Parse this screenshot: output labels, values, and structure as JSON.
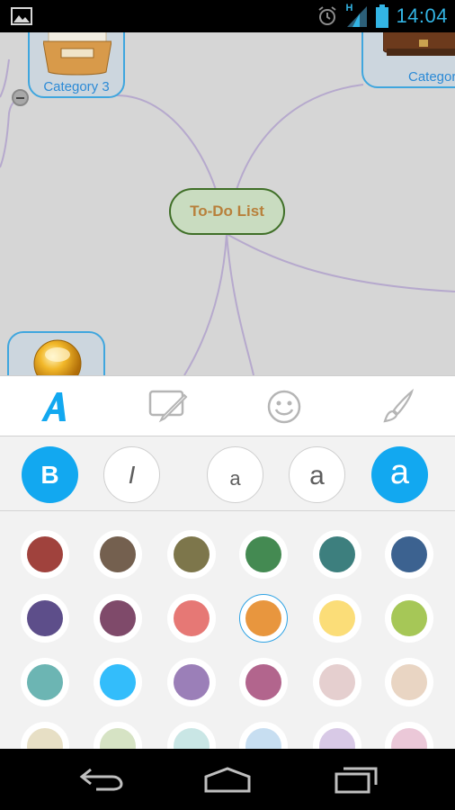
{
  "status_bar": {
    "time": "14:04",
    "network_label": "H",
    "left_icon": "image-icon",
    "right_icons": [
      "alarm-icon",
      "signal-icon",
      "battery-icon"
    ]
  },
  "mind_map": {
    "central_node": {
      "label": "To-Do List",
      "text_color": "#b8803b",
      "border_color": "#3f6f27",
      "fill_color": "#c9dcc0"
    },
    "nodes": [
      {
        "label": "Category 3",
        "icon": "tray-icon"
      },
      {
        "label": "Categor",
        "icon": "briefcase-icon"
      },
      {
        "label": "",
        "icon": "gold-ball-icon"
      }
    ],
    "link_color": "#b6a9cd",
    "node_border_color": "#3fa6de"
  },
  "format_panel": {
    "tabs": [
      {
        "name": "text-style",
        "icon": "font-a-icon",
        "active": true
      },
      {
        "name": "image",
        "icon": "image-brush-icon",
        "active": false
      },
      {
        "name": "emoji",
        "icon": "smiley-icon",
        "active": false
      },
      {
        "name": "brush",
        "icon": "brush-icon",
        "active": false
      }
    ],
    "styles": [
      {
        "label": "B",
        "active": true,
        "name": "bold"
      },
      {
        "label": "I",
        "active": false,
        "name": "italic"
      },
      {
        "label": "a",
        "active": false,
        "name": "size-small"
      },
      {
        "label": "a",
        "active": false,
        "name": "size-medium"
      },
      {
        "label": "a",
        "active": true,
        "name": "size-large"
      }
    ],
    "accent_color": "#12a8f0",
    "colors": [
      "#a0423d",
      "#74604f",
      "#7d764b",
      "#448a52",
      "#3d7f7e",
      "#3c6290",
      "#5d4e8a",
      "#7f4a6a",
      "#e67875",
      "#e8963e",
      "#fbdd78",
      "#a6c757",
      "#6cb5b3",
      "#33bdfb",
      "#9b7fb8",
      "#b2658d",
      "#e5cfcf",
      "#e9d5c3",
      "#e7dfc5",
      "#d6e3c4",
      "#c9e6e5",
      "#c7def1",
      "#d8c9e6",
      "#ebc8d8"
    ],
    "selected_color": "#e8963e"
  },
  "nav_bar": {
    "buttons": [
      "back-icon",
      "home-icon",
      "recents-icon"
    ]
  }
}
